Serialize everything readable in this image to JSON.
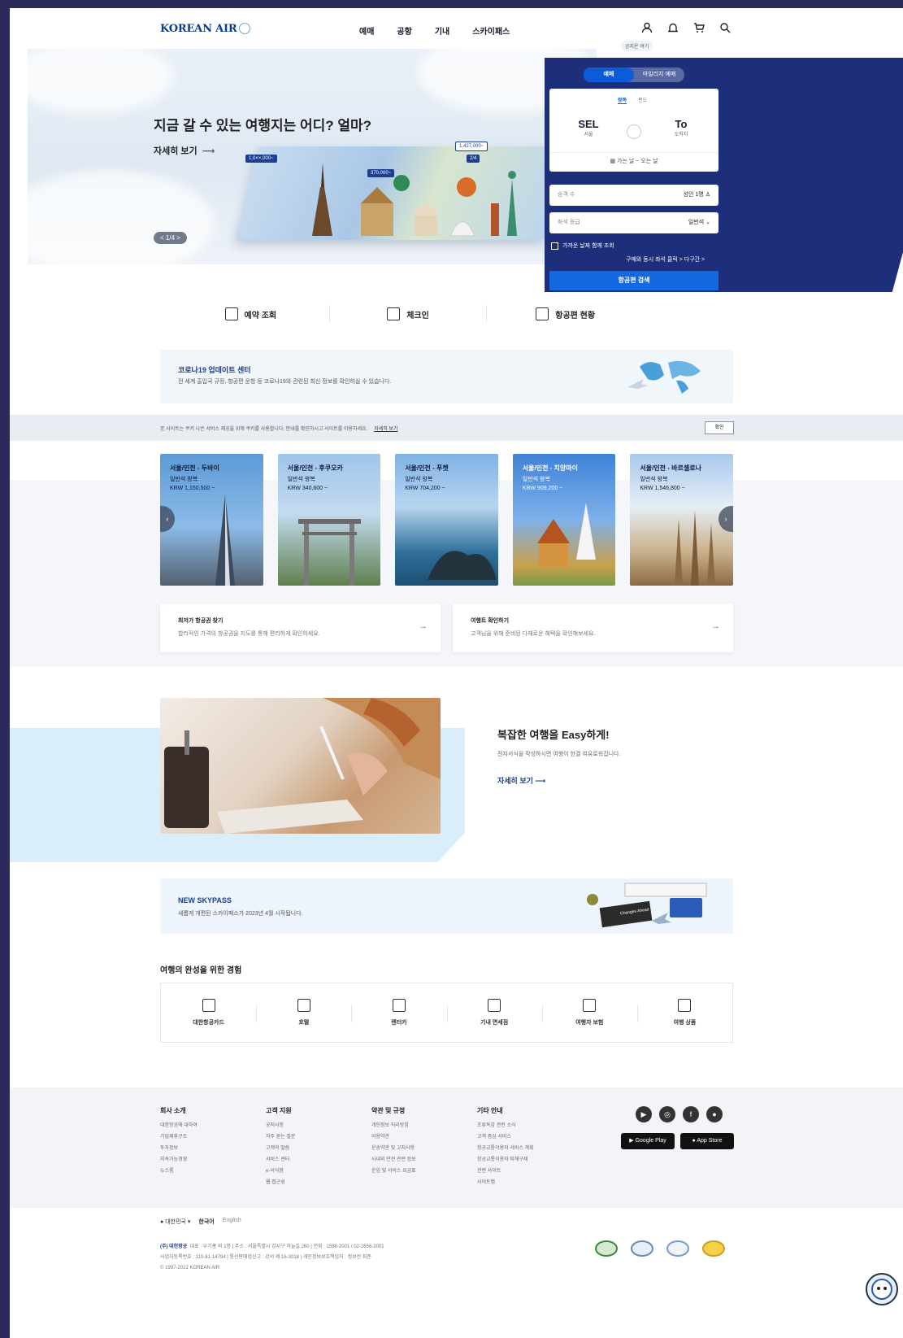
{
  "header": {
    "logo": "KOREAN AIR",
    "nav": [
      "예매",
      "공항",
      "기내",
      "스카이패스"
    ],
    "tooltip": "공지온 여기"
  },
  "hero": {
    "title": "지금 갈 수 있는 여행지는 어디? 얼마?",
    "more": "자세히 보기",
    "pager": "< 1/4 >",
    "tags": [
      "1,0××,000~",
      "370,000~",
      "1,427,000~",
      "2/4"
    ]
  },
  "booking": {
    "tabs": [
      "예매",
      "마일리지 예매"
    ],
    "trip_types": [
      "왕복",
      "편도"
    ],
    "from_code": "SEL",
    "from_city": "서울",
    "to_code": "To",
    "to_city": "도착지",
    "date": "가는 날 ~ 오는 날",
    "pax_label": "승객 수",
    "pax_value": "성인 1명",
    "class_label": "좌석 등급",
    "class_value": "일반석",
    "checkbox": "가까운 날짜 함께 조회",
    "links": "구매와 동시 좌석 클릭 >  다구간 >",
    "search": "항공편 검색"
  },
  "quick": [
    "예약 조회",
    "체크인",
    "항공편 현황"
  ],
  "covid": {
    "title": "코로나19 업데이트 센터",
    "desc": "전 세계 출입국 규정, 항공편 운항 등 코로나19와 관련된 최신 정보를 확인하실 수 있습니다."
  },
  "notice": {
    "text": "본 사이트는 쿠키 나은 서비스 제공을 위해 쿠키를 사용합니다. 안내를 확인하시고 사이트를 이용하세요.",
    "link": "자세히 보기",
    "button": "확인"
  },
  "destinations": [
    {
      "title": "서울/인천 - 두바이",
      "sub": "일반석 왕복",
      "price": "KRW 1,150,500 ~"
    },
    {
      "title": "서울/인천 - 후쿠오카",
      "sub": "일반석 왕복",
      "price": "KRW 340,600 ~"
    },
    {
      "title": "서울/인천 - 푸켓",
      "sub": "일반석 왕복",
      "price": "KRW 704,200 ~"
    },
    {
      "title": "서울/인천 - 치앙마이",
      "sub": "일반석 왕복",
      "price": "KRW 909,200 ~"
    },
    {
      "title": "서울/인천 - 바르셀로나",
      "sub": "일반석 왕복",
      "price": "KRW 1,546,800 ~"
    }
  ],
  "info_cards": [
    {
      "title": "최저가 항공권 찾기",
      "desc": "합리적인 가격의 항공권을 지도를 통해 편리하게 확인하세요."
    },
    {
      "title": "여행트 확인하기",
      "desc": "고객님을 위해 준비된 다채로운 혜택을 확인해보세요."
    }
  ],
  "easy": {
    "title": "복잡한 여행을 Easy하게!",
    "desc": "전자서식을 작성하시면 여행이 한결 여유로워집니다.",
    "more": "자세히 보기"
  },
  "skypass": {
    "title": "NEW SKYPASS",
    "desc": "새롭게 개편된 스카이패스가 2023년 4월 시작됩니다.",
    "card_text": "Changes Ahead"
  },
  "services": {
    "title": "여행의 완성을 위한 경험",
    "items": [
      "대한항공카드",
      "호텔",
      "렌터카",
      "기내 면세점",
      "여행자 보험",
      "여행 상품"
    ]
  },
  "footer": {
    "cols": [
      {
        "h": "회사 소개",
        "items": [
          "대한항공에 대하여",
          "기업제휴구조",
          "투자정보",
          "지속가능경영",
          "뉴스룸"
        ]
      },
      {
        "h": "고객 지원",
        "items": [
          "공지사항",
          "자주 묻는 질문",
          "고객의 말씀",
          "서비스 센터",
          "e-서식함",
          "웹 접근성"
        ]
      },
      {
        "h": "약관 및 규정",
        "items": [
          "개인정보 처리방침",
          "이용약관",
          "운송약관 및 고지사항",
          "사내외 안전 관련 정보",
          "운임 및 서비스 요금표"
        ]
      },
      {
        "h": "기타 안내",
        "items": [
          "조류독감 관련 소식",
          "고객 중심 서비스",
          "항공교통이용자 서비스 계획",
          "항공교통이용자 피해구제",
          "관련 사이트",
          "사이트맵"
        ]
      }
    ],
    "social": [
      "▶",
      "◎",
      "f",
      "●"
    ],
    "stores": [
      "Google Play",
      "App Store"
    ]
  },
  "bottom": {
    "region": "대한민국 ▾",
    "lang_ko": "한국어",
    "lang_en": "English",
    "company": "(주) 대한항공",
    "addr1": "대표 : 우기홍 외 1명  |  주소 : 서울특별시 강서구 하늘길 260  |  전화 : 1588-2001 / 02-2656-2001",
    "addr2": "사업자등록번호 : 110-81-14794  |  통신판매업신고 : 강서 제 16-3018  |  개인정보보호책임자 : 정보전 최준",
    "copy": "© 1997-2022 KOREAN AIR"
  },
  "colors": {
    "navy": "#1d2f7a",
    "brand_blue": "#1468e0",
    "text_blue": "#1c3c8f"
  }
}
